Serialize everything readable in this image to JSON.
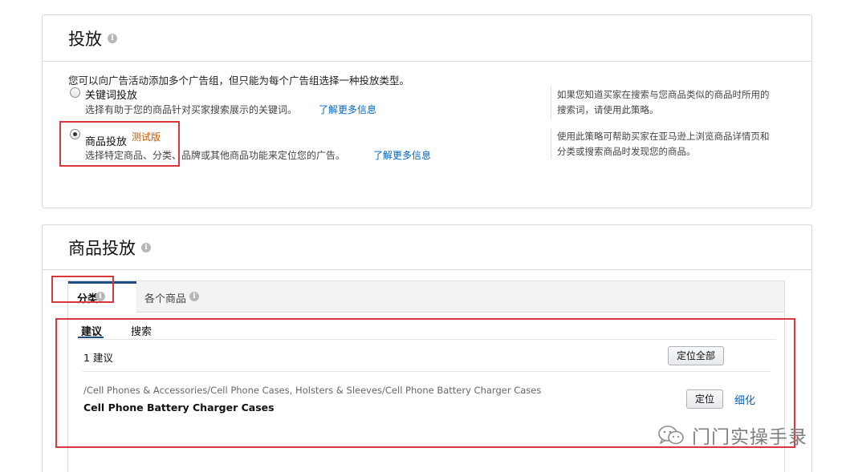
{
  "targeting_panel": {
    "title": "投放",
    "intro": "您可以向广告活动添加多个广告组，但只能为每个广告组选择一种投放类型。",
    "keyword_option": {
      "label": "关键词投放",
      "description": "选择有助于您的商品针对买家搜索展示的关键词。",
      "link": "了解更多信息",
      "selected": false,
      "help_line1": "如果您知道买家在搜索与您商品类似的商品时所用的",
      "help_line2": "搜索词，请使用此策略。"
    },
    "product_option": {
      "label": "商品投放",
      "badge": "测试版",
      "description": "选择特定商品、分类、品牌或其他商品功能来定位您的广告。",
      "link": "了解更多信息",
      "selected": true,
      "help_line1": "使用此策略可帮助买家在亚马逊上浏览商品详情页和",
      "help_line2": "分类或搜索商品时发现您的商品。"
    }
  },
  "product_targeting_panel": {
    "title": "商品投放",
    "tabs": [
      {
        "label": "分类",
        "active": true
      },
      {
        "label": "各个商品",
        "active": false
      }
    ],
    "subtabs": [
      {
        "label": "建议",
        "active": true
      },
      {
        "label": "搜索",
        "active": false
      }
    ],
    "suggestion_count": "1 建议",
    "target_all_button": "定位全部",
    "results": [
      {
        "path": "/Cell Phones & Accessories/Cell Phone Cases, Holsters & Sleeves/Cell Phone Battery Charger Cases",
        "name": "Cell Phone Battery Charger Cases",
        "target_button": "定位",
        "refine_link": "细化"
      }
    ]
  },
  "watermark": {
    "text": "门门实操手录",
    "icon": "wechat-icon"
  },
  "colors": {
    "link": "#0066c0",
    "beta": "#c45500",
    "highlight_box": "#d9363e",
    "tab_accent": "#1e4f80"
  }
}
